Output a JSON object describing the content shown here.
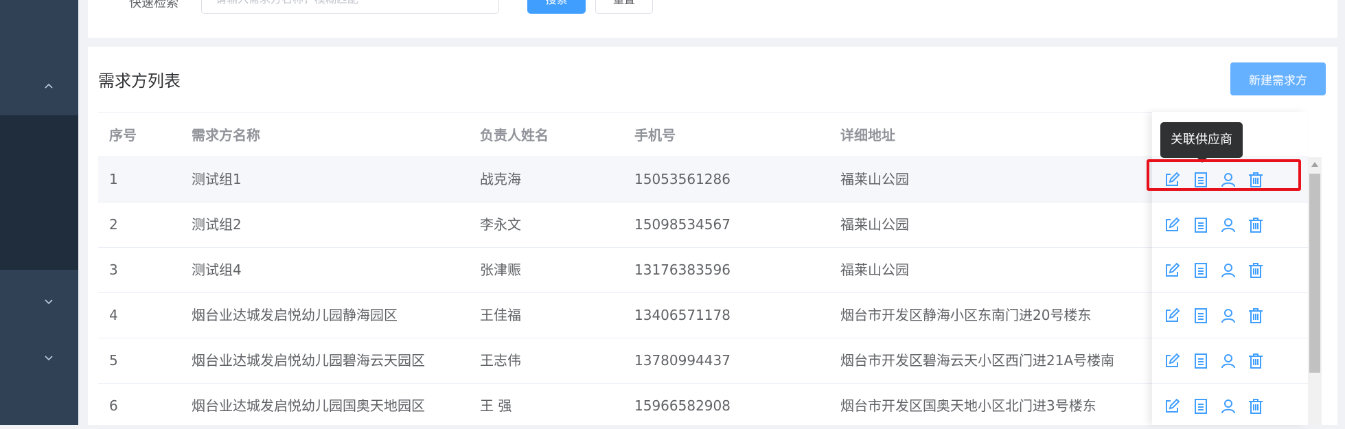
{
  "search": {
    "label": "快速检索",
    "placeholder": "请输入需求方名称，模糊匹配",
    "value": "",
    "search_button": "搜索",
    "reset_button": "重置"
  },
  "list": {
    "title": "需求方列表",
    "new_button": "新建需求方",
    "columns": [
      "序号",
      "需求方名称",
      "负责人姓名",
      "手机号",
      "详细地址"
    ],
    "rows": [
      {
        "idx": "1",
        "name": "测试组1",
        "person": "战克海",
        "phone": "15053561286",
        "address": "福莱山公园"
      },
      {
        "idx": "2",
        "name": "测试组2",
        "person": "李永文",
        "phone": "15098534567",
        "address": "福莱山公园"
      },
      {
        "idx": "3",
        "name": "测试组4",
        "person": "张津赈",
        "phone": "13176383596",
        "address": "福莱山公园"
      },
      {
        "idx": "4",
        "name": "烟台业达城发启悦幼儿园静海园区",
        "person": "王佳福",
        "phone": "13406571178",
        "address": "烟台市开发区静海小区东南门进20号楼东"
      },
      {
        "idx": "5",
        "name": "烟台业达城发启悦幼儿园碧海云天园区",
        "person": "王志伟",
        "phone": "13780994437",
        "address": "烟台市开发区碧海云天小区西门进21A号楼南"
      },
      {
        "idx": "6",
        "name": "烟台业达城发启悦幼儿园国奥天地园区",
        "person": "王 强",
        "phone": "15966582908",
        "address": "烟台市开发区国奥天地小区北门进3号楼东"
      }
    ]
  },
  "tooltip": {
    "text": "关联供应商"
  },
  "actions": [
    "edit-icon",
    "document-icon",
    "user-icon",
    "trash-icon"
  ],
  "colors": {
    "primary": "#409eff",
    "sidebar": "#304156",
    "highlight": "#e8101b",
    "tooltip": "#303133"
  }
}
